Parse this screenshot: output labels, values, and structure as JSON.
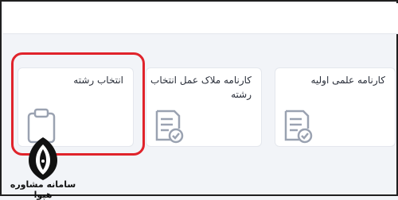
{
  "cards": [
    {
      "title": "کارنامه علمی اولیه",
      "icon": "report-check-icon"
    },
    {
      "title": "کارنامه ملاک عمل انتخاب رشته",
      "icon": "report-check-icon"
    },
    {
      "title": "انتخاب رشته",
      "icon": "clipboard-icon"
    }
  ],
  "highlight_color": "#e0232b",
  "watermark": {
    "text": "سامانه مشاوره هپوا"
  }
}
